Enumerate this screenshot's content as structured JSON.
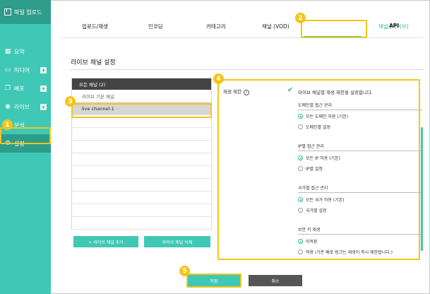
{
  "sidebar": {
    "upload_label": "파일 업로드",
    "items": [
      {
        "label": "요약",
        "icon": "grid-icon",
        "plus": false
      },
      {
        "label": "미디어",
        "icon": "monitor-icon",
        "plus": true
      },
      {
        "label": "배포",
        "icon": "copy-icon",
        "plus": true
      },
      {
        "label": "라이브",
        "icon": "broadcast-icon",
        "plus": true
      },
      {
        "label": "분석",
        "icon": "chart-icon",
        "plus": false
      },
      {
        "label": "설정",
        "icon": "gear-icon",
        "plus": false
      }
    ],
    "active": "설정"
  },
  "tabs": [
    "업로드/재생",
    "인코딩",
    "카테고리",
    "채널 (VOD)",
    "채널 (라이브)",
    "API"
  ],
  "active_tab": "채널 (라이브)",
  "section_title": "라이브 채널 설정",
  "channel_list": {
    "header": "모든 채널 (2)",
    "rows": [
      "라이브 기본 채널",
      "live channel-1"
    ],
    "selected": "live channel-1",
    "add_button": "+ 라이브 채널 추가",
    "delete_button": "라이브 채널 삭제"
  },
  "settings": {
    "playback_limit_label": "재생 제한",
    "playback_limit_check": "라이브 채널별 재생 제한을 설정합니다.",
    "groups": [
      {
        "title": "도메인별 접근 관리",
        "options": [
          "모든 도메인 허용 (기본)",
          "도메인별 설정"
        ],
        "selected": 0
      },
      {
        "title": "IP별 접근 관리",
        "options": [
          "모든 IP 허용 (기본)",
          "IP별 설정"
        ],
        "selected": 0
      },
      {
        "title": "국가별 접근 관리",
        "options": [
          "모든 국가 허용 (기본)",
          "국가별 설정"
        ],
        "selected": 0
      },
      {
        "title": "보안 키 재생",
        "options": [
          "미적용",
          "적용 (기존 배포 링크는 재생이 즉시 제한됩니다.)"
        ],
        "selected": 0
      }
    ]
  },
  "buttons": {
    "save": "저장",
    "cancel": "취소"
  },
  "callouts": [
    "1",
    "2",
    "3",
    "4",
    "5"
  ],
  "colors": {
    "accent": "#3fc8b5",
    "accent_dark": "#2d9c8b",
    "callout": "#f5c518"
  }
}
